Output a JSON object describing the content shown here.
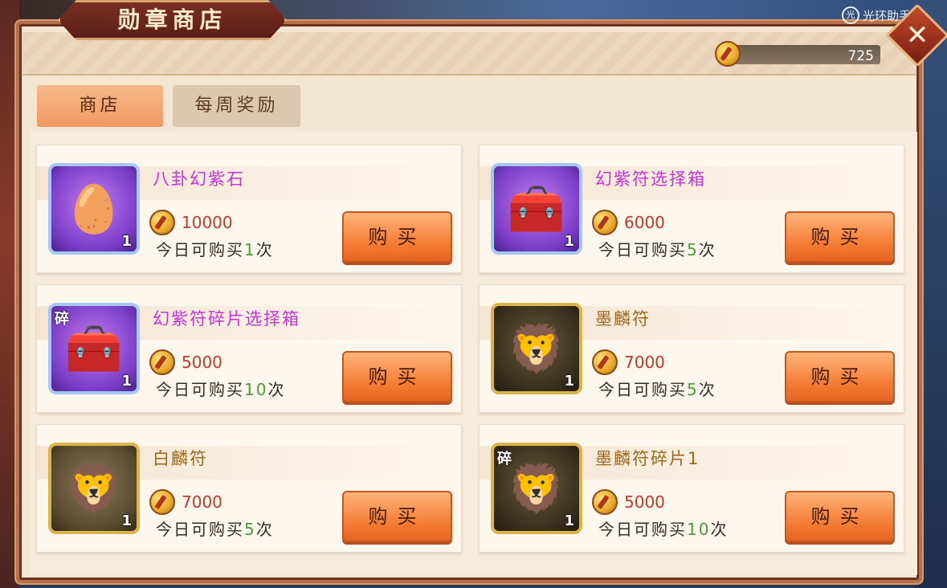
{
  "header": {
    "title": "勋章商店",
    "watermark": "光环助手",
    "watermark_badge": "光",
    "close_glyph": "✕",
    "currency_value": "725"
  },
  "tabs": [
    {
      "label": "商店",
      "active": true
    },
    {
      "label": "每周奖励",
      "active": false
    }
  ],
  "items": [
    {
      "name": "八卦幻紫石",
      "price": "10000",
      "limit_prefix": "今日可购买",
      "limit_num": "1",
      "limit_suffix": "次",
      "count": "1",
      "buy": "购买",
      "fragment": "",
      "name_color": "purple",
      "icon": "gem"
    },
    {
      "name": "幻紫符选择箱",
      "price": "6000",
      "limit_prefix": "今日可购买",
      "limit_num": "5",
      "limit_suffix": "次",
      "count": "1",
      "buy": "购买",
      "fragment": "",
      "name_color": "purple",
      "icon": "chest"
    },
    {
      "name": "幻紫符碎片选择箱",
      "price": "5000",
      "limit_prefix": "今日可购买",
      "limit_num": "10",
      "limit_suffix": "次",
      "count": "1",
      "buy": "购买",
      "fragment": "碎",
      "name_color": "purple",
      "icon": "chest"
    },
    {
      "name": "墨麟符",
      "price": "7000",
      "limit_prefix": "今日可购买",
      "limit_num": "5",
      "limit_suffix": "次",
      "count": "1",
      "buy": "购买",
      "fragment": "",
      "name_color": "gold",
      "icon": "qilin-dark"
    },
    {
      "name": "白麟符",
      "price": "7000",
      "limit_prefix": "今日可购买",
      "limit_num": "5",
      "limit_suffix": "次",
      "count": "1",
      "buy": "购买",
      "fragment": "",
      "name_color": "gold",
      "icon": "qilin-light"
    },
    {
      "name": "墨麟符碎片1",
      "price": "5000",
      "limit_prefix": "今日可购买",
      "limit_num": "10",
      "limit_suffix": "次",
      "count": "1",
      "buy": "购买",
      "fragment": "碎",
      "name_color": "gold",
      "icon": "qilin-dark"
    }
  ],
  "colors": {
    "purple_name": "#c334d8",
    "gold_name": "#9a6a1c",
    "price": "#c0392b",
    "limit_num": "#4e9a3a",
    "buy_button": "#f2782f"
  }
}
